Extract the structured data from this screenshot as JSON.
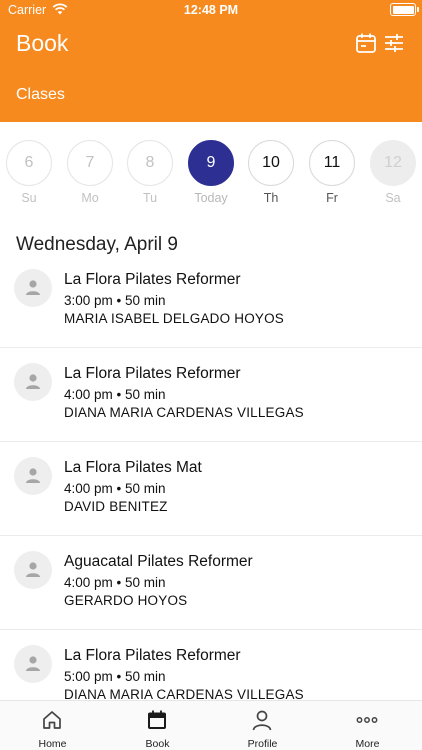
{
  "status_bar": {
    "carrier": "Carrier",
    "time": "12:48 PM"
  },
  "header": {
    "title": "Book",
    "subtitle": "Clases",
    "icons": [
      "calendar-icon",
      "filter-sliders-icon"
    ],
    "color": "#F68A1F"
  },
  "days": [
    {
      "number": "6",
      "label": "Su",
      "state": "past"
    },
    {
      "number": "7",
      "label": "Mo",
      "state": "past"
    },
    {
      "number": "8",
      "label": "Tu",
      "state": "past"
    },
    {
      "number": "9",
      "label": "Today",
      "state": "selected"
    },
    {
      "number": "10",
      "label": "Th",
      "state": "active"
    },
    {
      "number": "11",
      "label": "Fr",
      "state": "active"
    },
    {
      "number": "12",
      "label": "Sa",
      "state": "disabled"
    }
  ],
  "selected_color": "#2D3092",
  "date_heading": "Wednesday, April 9",
  "classes": [
    {
      "title": "La Flora Pilates Reformer",
      "time": "3:00 pm • 50 min",
      "instructor": "MARIA ISABEL DELGADO HOYOS"
    },
    {
      "title": "La Flora Pilates Reformer",
      "time": "4:00 pm • 50 min",
      "instructor": "DIANA MARIA CARDENAS VILLEGAS"
    },
    {
      "title": "La Flora Pilates Mat",
      "time": "4:00 pm • 50 min",
      "instructor": "DAVID BENITEZ"
    },
    {
      "title": "Aguacatal Pilates Reformer",
      "time": "4:00 pm • 50 min",
      "instructor": "GERARDO HOYOS"
    },
    {
      "title": "La Flora Pilates Reformer",
      "time": "5:00 pm • 50 min",
      "instructor": "DIANA MARIA CARDENAS VILLEGAS"
    }
  ],
  "tabbar": {
    "tabs": [
      {
        "label": "Home",
        "icon": "home-icon"
      },
      {
        "label": "Book",
        "icon": "calendar-icon",
        "selected": true
      },
      {
        "label": "Profile",
        "icon": "profile-icon"
      },
      {
        "label": "More",
        "icon": "more-dots-icon"
      }
    ]
  }
}
